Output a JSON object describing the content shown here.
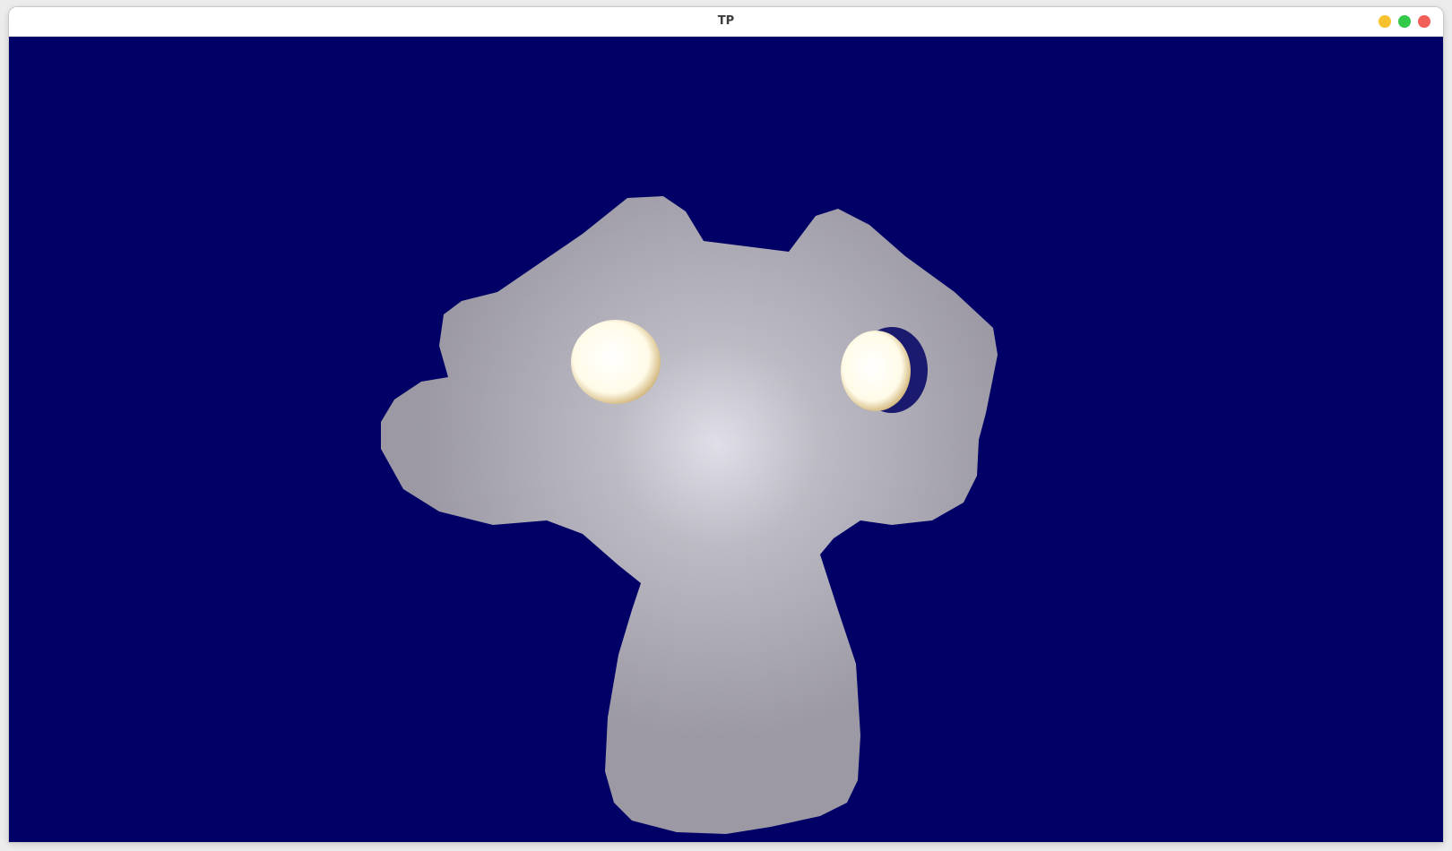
{
  "window": {
    "title": "TP",
    "controls": [
      {
        "name": "minimize",
        "color": "#f6c22e"
      },
      {
        "name": "maximize",
        "color": "#33c94a"
      },
      {
        "name": "close",
        "color": "#f25f58"
      }
    ]
  },
  "viewport": {
    "background_color": "#000066",
    "model_color": "#9e9ba6",
    "eye_highlight_color": "#fffbe8"
  }
}
